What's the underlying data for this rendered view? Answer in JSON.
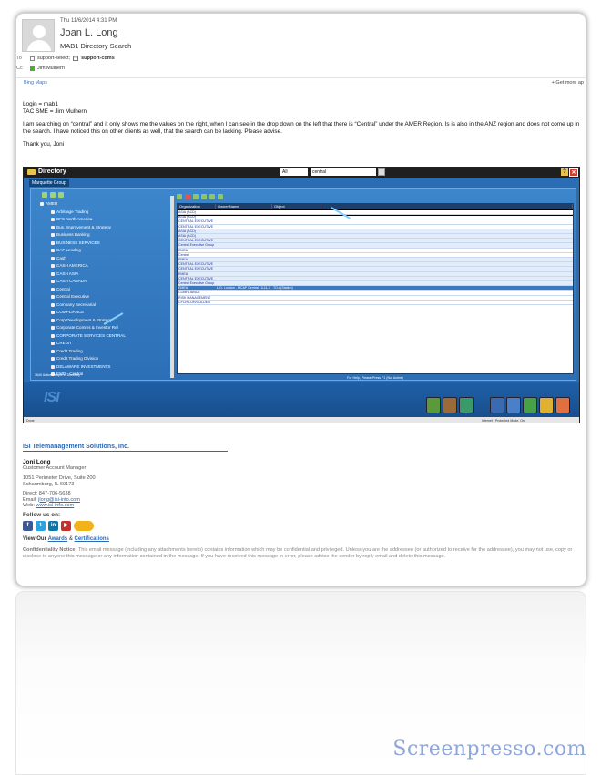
{
  "email": {
    "date": "Thu 11/6/2014 4:31 PM",
    "from": "Joan L. Long",
    "subject": "MAB1 Directory Search",
    "to_label": "To",
    "to_1": "support-select;",
    "to_2": "support-cdms",
    "cc_label": "Cc",
    "cc_1": "Jim Mulhern",
    "bing": "Bing Maps",
    "get_more": "Get more ap"
  },
  "body": {
    "line1": "Login = mab1",
    "line2": "TAC SME = Jim Mulhern",
    "para": "I am searching on “central” and it only shows me the values on the right, when I can see in the drop down on the left that there is “Central” under the AMER Region.  Is is also in the ANZ region and does not come up in the search.  I have noticed this on other clients as well, that the search can be lacking.  Please advise.",
    "thanks": "Thank you, Joni"
  },
  "app": {
    "title": "Directory",
    "select_value": "All",
    "search_value": "central",
    "help": "?",
    "close": "✕",
    "group": "Marquette Group",
    "tree": [
      "AMER",
      "Arbitrage Trading",
      "BFS North America",
      "Bus. Improvement & Strategy",
      "Business Banking",
      "BUSINESS SERVICES",
      "CAF Lending",
      "Cash",
      "CASH AMERICA",
      "CASH ASIA",
      "CASH CANADA",
      "Central",
      "Central Executive",
      "Company Secretarial",
      "COMPLIANCE",
      "Corp Development & Strategy",
      "Corporate Comms & Investor Rel",
      "CORPORATE SERVICES CENTRAL",
      "CREDIT",
      "Credit Trading",
      "Credit Trading Division",
      "DELAWARE INVESTMENTS",
      "EMD - Central"
    ],
    "tree_footer": "3640 Active People in Directory",
    "columns": [
      "Organization",
      "Owner Name",
      "Object",
      ""
    ],
    "rows": [
      [
        "ASIA (ACD)",
        "",
        "",
        ""
      ],
      [
        "ASIA (ACD)",
        "",
        "",
        ""
      ],
      [
        "CENTRAL EXECUTIVE",
        "",
        "",
        ""
      ],
      [
        "CENTRAL EXECUTIVE",
        "",
        "",
        ""
      ],
      [
        "ASIA (ACD)",
        "",
        "",
        ""
      ],
      [
        "ASIA (ACD)",
        "",
        "",
        ""
      ],
      [
        "CENTRAL EXECUTIVE",
        "",
        "",
        ""
      ],
      [
        "Central Executive Group",
        "",
        "",
        ""
      ],
      [
        "EMEA",
        "",
        "",
        ""
      ],
      [
        "Central",
        "",
        "",
        ""
      ],
      [
        "EMEA",
        "",
        "",
        ""
      ],
      [
        "CENTRAL EXECUTIVE",
        "",
        "",
        ""
      ],
      [
        "CENTRAL EXECUTIVE",
        "",
        "",
        ""
      ],
      [
        "EMEA",
        "",
        "",
        ""
      ],
      [
        "CENTRAL EXECUTIVE",
        "",
        "",
        ""
      ],
      [
        "Central Executive Group",
        "",
        "",
        ""
      ],
      [
        "EMEA",
        "L.O. London - MCAF Central 10-11-3",
        "TO-6(Station)",
        ""
      ],
      [
        "COMPLIANCE",
        "",
        "",
        ""
      ],
      [
        "RISK MANAGEMENT",
        "",
        "",
        ""
      ],
      [
        "CFO/RLOR/GOLDEN",
        "",
        "",
        ""
      ]
    ],
    "grid_footer": "For Help, Please Press F1 (Not Active)",
    "logo": "ISI",
    "taskbar_left": "Done",
    "taskbar_right": "Internet | Protected Mode: On"
  },
  "signature": {
    "company": "ISI Telemanagement Solutions, Inc.",
    "name": "Joni Long",
    "title": "Customer Account Manager",
    "addr1": "1051 Perimeter Drive, Suite 200",
    "addr2": "Schaumburg, IL 60173",
    "direct_label": "Direct:",
    "direct": "847-706-5638",
    "email_label": "Email:",
    "email": "jlong@isi-info.com",
    "web_label": "Web:",
    "web": "www.isi-info.com",
    "follow": "Follow us on:",
    "view_our": "View Our",
    "awards": "Awards",
    "amp": "&",
    "certifications": "Certifications",
    "conf_label": "Confidentiality Notice:",
    "conf_text": "This email message (including any attachments hereto) contains information which may be confidential and privileged. Unless you are the addressee (or authorized to receive for the addressee), you may not use, copy or disclose to anyone this message or any information contained in the message. If you have received this message in error, please advise the sender by reply email and delete this message."
  },
  "watermark": "Screenpresso.com",
  "colors": {
    "accent": "#2e69b5",
    "app_blue": "#2a6db4",
    "presence": "#4caf2a"
  }
}
